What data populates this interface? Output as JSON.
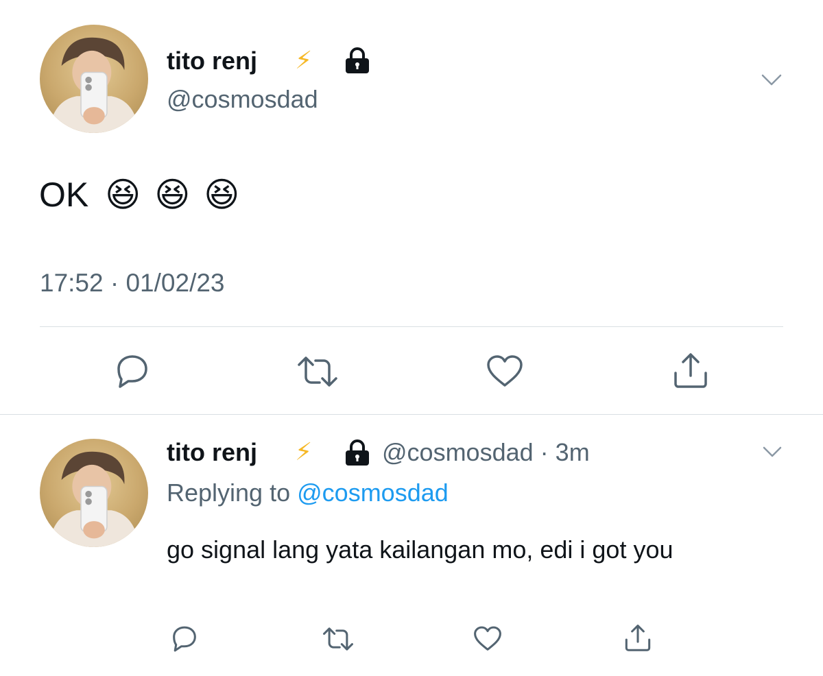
{
  "main_tweet": {
    "display_name": "tito renj",
    "verified_emoji": "⚡",
    "handle": "@cosmosdad",
    "text": "OK",
    "emojis": [
      "😆",
      "😆",
      "😆"
    ],
    "time": "17:52",
    "separator": "·",
    "date": "01/02/23"
  },
  "reply": {
    "display_name": "tito renj",
    "verified_emoji": "⚡",
    "handle": "@cosmosdad",
    "separator": "·",
    "age": "3m",
    "replying_prefix": "Replying to",
    "replying_handle": "@cosmosdad",
    "text": "go signal lang yata kailangan mo, edi i got you"
  },
  "icons": {
    "lock": "lock-icon",
    "chevron": "chevron-down-icon",
    "reply": "reply-icon",
    "retweet": "retweet-icon",
    "like": "like-icon",
    "share": "share-icon"
  },
  "colors": {
    "text_primary": "#0f1419",
    "text_secondary": "#536471",
    "link": "#1d9bf0",
    "divider": "#d9dfe3"
  }
}
